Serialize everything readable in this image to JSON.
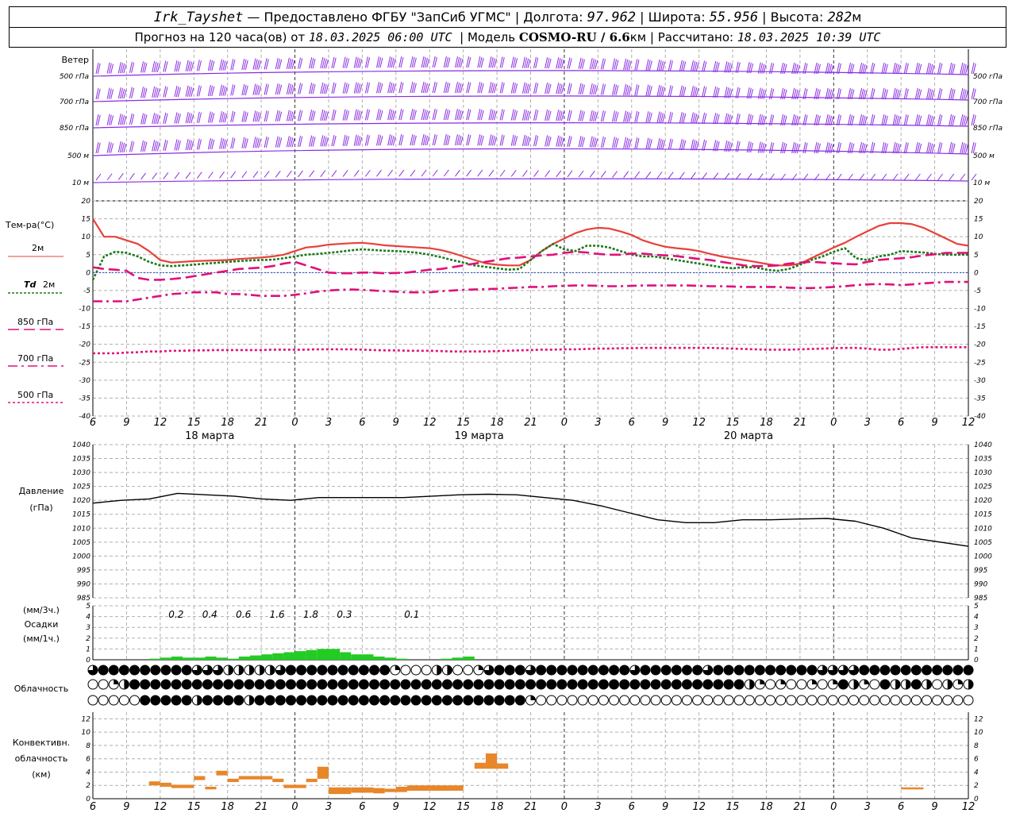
{
  "header": {
    "station": "Irk_Tayshet",
    "provider": "— Предоставлено ФГБУ \"ЗапСиб УГМС\"",
    "lon_label": "Долгота:",
    "lon": "97.962",
    "lat_label": "Широта:",
    "lat": "55.956",
    "alt_label": "Высота:",
    "alt": "282",
    "alt_unit": "м",
    "forecast_prefix": "Прогноз на 120 часа(ов) от",
    "forecast_from": "18.03.2025 06:00 UTC",
    "model_label": "Модель",
    "model": "COSMO-RU / 6.6",
    "model_unit": "км",
    "calc_label": "Рассчитано:",
    "calc_time": "18.03.2025 10:39 UTC"
  },
  "labels": {
    "wind_title": "Ветер",
    "wind_levels": [
      "500 гПа",
      "700 гПа",
      "850 гПа",
      "500 м",
      "10 м"
    ],
    "temp_title": "Тем-ра(°С)",
    "t2m": "2м",
    "td_a": "Td",
    "td_b": "2м",
    "t850": "850 гПа",
    "t700": "700 гПа",
    "t500": "500 гПа",
    "pres_a": "Давление",
    "pres_b": "(гПа)",
    "prec_a": "(мм/3ч.)",
    "prec_b": "Осадки",
    "prec_c": "(мм/1ч.)",
    "cloud": "Облачность",
    "conv_a": "Конвективн.",
    "conv_b": "облачность",
    "conv_c": "(км)"
  },
  "colors": {
    "t2m": "#e8403a",
    "td": "#1a7a1a",
    "t850": "#e0107a",
    "wind": "#8a2be2",
    "precip": "#22cc22",
    "conv": "#e8862a",
    "grid": "#b0b0b0"
  },
  "time_axis": {
    "hours": [
      "6",
      "9",
      "12",
      "15",
      "18",
      "21",
      "0",
      "3",
      "6",
      "9",
      "12",
      "15",
      "18",
      "21",
      "0",
      "3",
      "6",
      "9",
      "12",
      "15",
      "18",
      "21",
      "0",
      "3",
      "6",
      "9",
      "12"
    ],
    "days": [
      "18 марта",
      "19 марта",
      "20 марта"
    ]
  },
  "chart_data": [
    {
      "type": "line",
      "title": "Тем-ра(°С)",
      "x_hours_from_start": [
        0,
        1,
        2,
        3,
        4,
        5,
        6,
        7,
        8,
        9,
        10,
        11,
        12,
        13,
        14,
        15,
        16,
        17,
        18,
        19,
        20,
        21,
        22,
        23,
        24,
        25,
        26,
        27,
        28,
        29,
        30,
        31,
        32,
        33,
        34,
        35,
        36,
        37,
        38,
        39,
        40,
        41,
        42,
        43,
        44,
        45,
        46,
        47,
        48,
        49,
        50,
        51,
        52,
        53,
        54,
        55,
        56,
        57,
        58,
        59,
        60,
        61,
        62,
        63,
        64,
        65,
        66,
        67,
        68,
        69,
        70,
        71,
        72,
        73,
        74,
        75,
        76,
        77,
        78
      ],
      "ylim": [
        -40,
        20
      ],
      "yticks": [
        20,
        15,
        10,
        5,
        0,
        -5,
        -10,
        -15,
        -20,
        -25,
        -30,
        -35,
        -40
      ],
      "series": [
        {
          "name": "2м",
          "values": [
            15,
            10,
            10,
            9,
            8,
            6,
            3.5,
            2.8,
            3,
            3.2,
            3.3,
            3.4,
            3.5,
            3.8,
            4,
            4.2,
            4.5,
            5,
            6,
            7,
            7.3,
            7.8,
            8,
            8.2,
            8.3,
            8,
            7.6,
            7.4,
            7.2,
            7,
            6.8,
            6.3,
            5.5,
            4.5,
            3.5,
            2.6,
            2.2,
            2,
            2,
            3.5,
            6,
            8,
            9.5,
            11,
            12,
            12.5,
            12.3,
            11.5,
            10.5,
            9,
            8,
            7.2,
            6.8,
            6.5,
            6,
            5.2,
            4.5,
            4,
            3.5,
            3,
            2.4,
            2,
            2,
            2.5,
            4,
            5.5,
            7,
            8.3,
            10,
            11.5,
            13,
            13.8,
            13.8,
            13.5,
            12.5,
            11,
            9.5,
            8,
            7.5
          ]
        },
        {
          "name": "Td 2м",
          "values": [
            -2,
            4.5,
            5.8,
            5.5,
            4.5,
            3,
            2,
            1.8,
            2,
            2.2,
            2.5,
            2.7,
            3,
            3.2,
            3.4,
            3.5,
            3.6,
            4,
            4.5,
            5,
            5.2,
            5.5,
            5.8,
            6.2,
            6.5,
            6.3,
            6.1,
            6,
            5.8,
            5.5,
            5,
            4.3,
            3.5,
            2.8,
            2,
            1.6,
            1.2,
            0.8,
            1,
            3.5,
            6,
            8,
            6.5,
            6,
            7.5,
            7.5,
            7,
            6,
            5,
            4.5,
            4.5,
            4,
            3.5,
            3,
            2.5,
            2,
            1.5,
            1.2,
            1.5,
            1.5,
            0.8,
            0.5,
            1,
            2.2,
            3.5,
            4.5,
            5.8,
            6.8,
            4,
            3.5,
            4.5,
            5,
            6,
            5.8,
            5.6,
            5.2,
            5,
            5,
            5
          ]
        },
        {
          "name": "850 гПа",
          "values": [
            1.5,
            1,
            0.8,
            0.5,
            -1.5,
            -2,
            -2,
            -1.8,
            -1.5,
            -1,
            -0.5,
            0,
            0.5,
            1,
            1.2,
            1.4,
            1.8,
            2.5,
            3,
            2,
            1,
            0,
            -0.2,
            -0.2,
            0,
            0,
            -0.2,
            -0.1,
            0,
            0.4,
            0.8,
            1,
            1.5,
            2,
            2.5,
            3,
            3.5,
            4,
            4.2,
            4.5,
            4.8,
            5,
            5.5,
            5.8,
            5.6,
            5.2,
            5,
            5,
            5.3,
            5.3,
            5,
            4.8,
            4.6,
            4.2,
            3.8,
            3.5,
            3,
            2.5,
            2,
            1.8,
            1.8,
            2,
            2.5,
            2.8,
            3,
            2.8,
            2.6,
            2.4,
            2.3,
            3,
            3.5,
            3.8,
            4,
            4.3,
            4.8,
            5.1,
            5.5,
            5.5,
            5.5
          ]
        },
        {
          "name": "700 гПа",
          "values": [
            -8,
            -8,
            -8,
            -8,
            -7.5,
            -7,
            -6.5,
            -6,
            -5.8,
            -5.5,
            -5.5,
            -5.5,
            -6,
            -6,
            -6.2,
            -6.5,
            -6.5,
            -6.5,
            -6.2,
            -5.8,
            -5.3,
            -5,
            -4.8,
            -4.7,
            -4.8,
            -5,
            -5.2,
            -5.3,
            -5.5,
            -5.5,
            -5.5,
            -5.2,
            -5,
            -4.8,
            -4.7,
            -4.6,
            -4.5,
            -4.3,
            -4.2,
            -4,
            -4,
            -3.8,
            -3.7,
            -3.6,
            -3.6,
            -3.7,
            -3.8,
            -3.8,
            -3.7,
            -3.6,
            -3.6,
            -3.6,
            -3.6,
            -3.6,
            -3.7,
            -3.8,
            -3.8,
            -3.9,
            -4,
            -4,
            -4,
            -4,
            -4.2,
            -4.3,
            -4.3,
            -4.2,
            -4,
            -3.8,
            -3.5,
            -3.3,
            -3.2,
            -3.3,
            -3.5,
            -3.3,
            -3,
            -2.8,
            -2.6,
            -2.6,
            -2.6
          ]
        },
        {
          "name": "500 гПа",
          "values": [
            -22.5,
            -22.5,
            -22.5,
            -22.3,
            -22.2,
            -22,
            -22,
            -21.8,
            -21.8,
            -21.7,
            -21.7,
            -21.6,
            -21.6,
            -21.6,
            -21.6,
            -21.6,
            -21.5,
            -21.5,
            -21.5,
            -21.5,
            -21.4,
            -21.4,
            -21.4,
            -21.4,
            -21.5,
            -21.6,
            -21.7,
            -21.7,
            -21.8,
            -21.8,
            -21.8,
            -21.9,
            -22,
            -22,
            -22,
            -22,
            -21.9,
            -21.8,
            -21.7,
            -21.6,
            -21.5,
            -21.5,
            -21.4,
            -21.4,
            -21.3,
            -21.2,
            -21.2,
            -21.1,
            -21.1,
            -21,
            -21,
            -21,
            -21,
            -21,
            -21,
            -21,
            -21.1,
            -21.2,
            -21.3,
            -21.4,
            -21.5,
            -21.5,
            -21.5,
            -21.4,
            -21.3,
            -21.2,
            -21.1,
            -21,
            -21,
            -21.2,
            -21.5,
            -21.5,
            -21.3,
            -21,
            -20.8,
            -20.8,
            -20.8,
            -20.8,
            -20.8
          ]
        }
      ]
    },
    {
      "type": "line",
      "title": "Давление",
      "ylabel": "(гПа)",
      "ylim": [
        985,
        1040
      ],
      "yticks": [
        1040,
        1035,
        1030,
        1025,
        1020,
        1015,
        1010,
        1005,
        1000,
        995,
        990,
        985
      ],
      "x_hours_from_start": [
        0,
        3,
        6,
        9,
        12,
        15,
        18,
        21,
        24,
        27,
        30,
        33,
        36,
        39,
        42,
        45,
        48,
        51,
        54,
        57,
        60,
        63,
        66,
        69,
        72,
        75,
        78
      ],
      "series": [
        {
          "name": "Давление",
          "values": [
            1019,
            1020,
            1020.5,
            1022.5,
            1022,
            1021.5,
            1020.5,
            1020,
            1021,
            1021,
            1021,
            1021,
            1021.5,
            1022,
            1022.2,
            1022,
            1021,
            1020,
            1018,
            1015.5,
            1013,
            1012,
            1012,
            1013,
            1013,
            1013.3,
            1013.5,
            1012.5,
            1010,
            1006.5,
            1005,
            1003.5
          ]
        }
      ]
    },
    {
      "type": "bar",
      "title": "Осадки",
      "ylim": [
        0,
        5
      ],
      "yticks": [
        5,
        4,
        3,
        2,
        1,
        0
      ],
      "x_hours_from_start": [
        5,
        6,
        7,
        8,
        9,
        10,
        11,
        12,
        13,
        14,
        15,
        16,
        17,
        18,
        19,
        20,
        21,
        22,
        23,
        24,
        25,
        26,
        27,
        28,
        29,
        30,
        31,
        32,
        33,
        34
      ],
      "values": [
        0.1,
        0.2,
        0.3,
        0.2,
        0.2,
        0.3,
        0.2,
        0.1,
        0.3,
        0.4,
        0.5,
        0.6,
        0.7,
        0.8,
        0.9,
        1,
        1,
        0.7,
        0.5,
        0.5,
        0.3,
        0.2,
        0.1,
        0,
        0,
        0,
        0.1,
        0.2,
        0.3,
        0
      ],
      "annotations_3h": [
        {
          "x": 6,
          "label": "0.2"
        },
        {
          "x": 9,
          "label": "0.4"
        },
        {
          "x": 12,
          "label": "0.6"
        },
        {
          "x": 15,
          "label": "1.6"
        },
        {
          "x": 18,
          "label": "1.8"
        },
        {
          "x": 21,
          "label": "0.3"
        },
        {
          "x": 27,
          "label": "0.1"
        }
      ]
    },
    {
      "type": "bar",
      "title": "Конвективн. облачность (км)",
      "ylim": [
        0,
        13
      ],
      "yticks": [
        12,
        10,
        8,
        6,
        4,
        2,
        0
      ],
      "segments": [
        {
          "x0": 5,
          "x1": 6,
          "low": 2,
          "high": 2.6
        },
        {
          "x0": 6,
          "x1": 7,
          "low": 1.8,
          "high": 2.4
        },
        {
          "x0": 7,
          "x1": 9,
          "low": 1.6,
          "high": 2.1
        },
        {
          "x0": 9,
          "x1": 10,
          "low": 2.8,
          "high": 3.4
        },
        {
          "x0": 10,
          "x1": 11,
          "low": 1.4,
          "high": 1.8
        },
        {
          "x0": 11,
          "x1": 12,
          "low": 3.5,
          "high": 4.2
        },
        {
          "x0": 12,
          "x1": 13,
          "low": 2.5,
          "high": 3
        },
        {
          "x0": 13,
          "x1": 16,
          "low": 2.9,
          "high": 3.4
        },
        {
          "x0": 16,
          "x1": 17,
          "low": 2.5,
          "high": 3
        },
        {
          "x0": 17,
          "x1": 19,
          "low": 1.6,
          "high": 2.1
        },
        {
          "x0": 19,
          "x1": 20,
          "low": 2.5,
          "high": 3
        },
        {
          "x0": 20,
          "x1": 21,
          "low": 3,
          "high": 4.8
        },
        {
          "x0": 21,
          "x1": 23,
          "low": 0.7,
          "high": 1.7
        },
        {
          "x0": 23,
          "x1": 25,
          "low": 0.9,
          "high": 1.7
        },
        {
          "x0": 25,
          "x1": 26,
          "low": 0.8,
          "high": 1.6
        },
        {
          "x0": 26,
          "x1": 27,
          "low": 1,
          "high": 1.5
        },
        {
          "x0": 27,
          "x1": 28,
          "low": 1,
          "high": 1.8
        },
        {
          "x0": 28,
          "x1": 30,
          "low": 1.2,
          "high": 2
        },
        {
          "x0": 30,
          "x1": 33,
          "low": 1.2,
          "high": 2
        },
        {
          "x0": 34,
          "x1": 35,
          "low": 4.5,
          "high": 5.4
        },
        {
          "x0": 35,
          "x1": 36,
          "low": 4.5,
          "high": 6.8
        },
        {
          "x0": 36,
          "x1": 37,
          "low": 4.5,
          "high": 5.3
        },
        {
          "x0": 72,
          "x1": 74,
          "low": 1.4,
          "high": 1.7
        }
      ]
    }
  ],
  "cloud_rows": {
    "levels": [
      0,
      1,
      2,
      3,
      4
    ],
    "top": "3444444444333222223444444444410002200134443444444444344444434444444444333344444444444",
    "mid": "0012444444444444444444444444444444444444444444444444444444444442101001014210422420212",
    "low": "0000044444244442444444444444444444444444441000000000000000000000000000000000000000000"
  }
}
